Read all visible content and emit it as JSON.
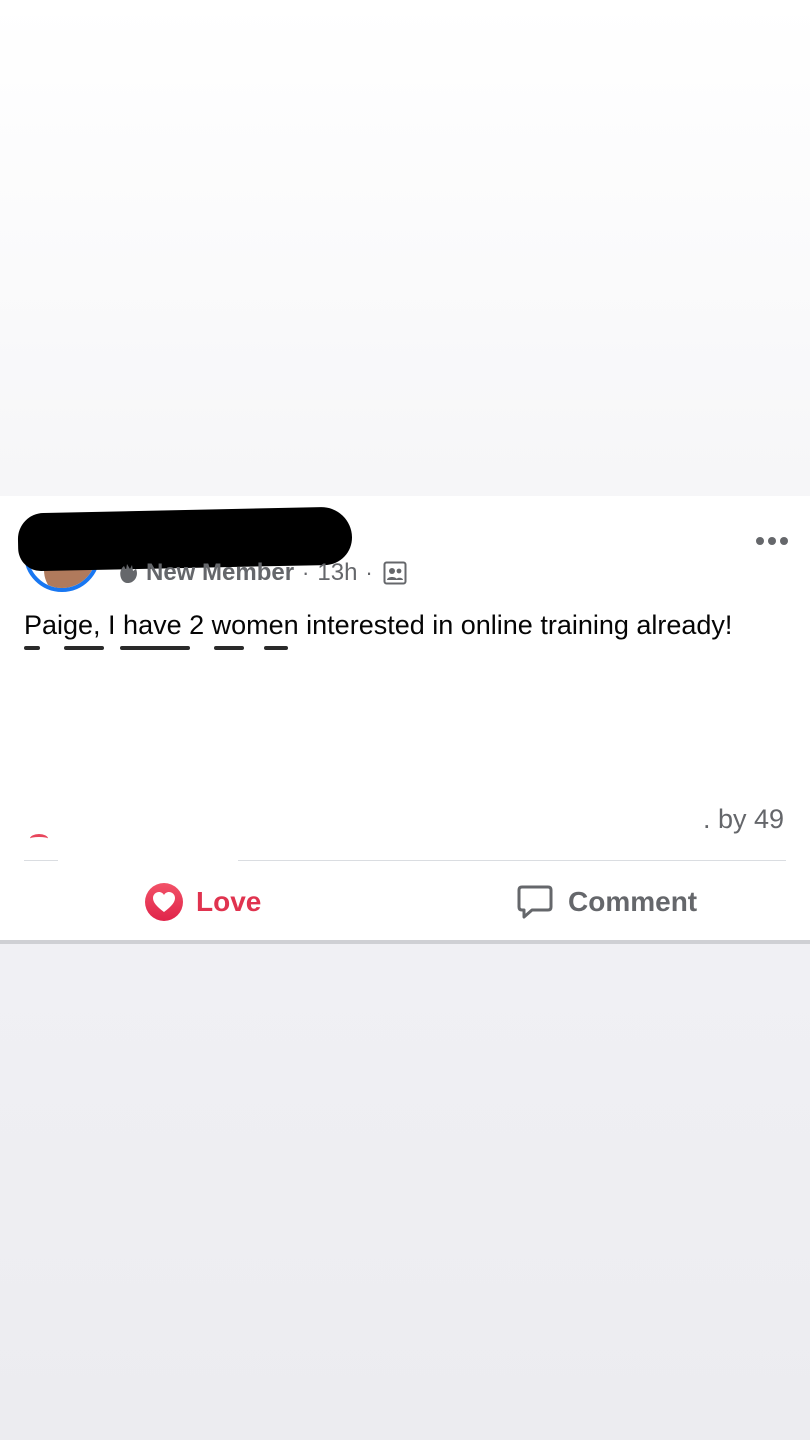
{
  "post": {
    "author_badge_label": "New Member",
    "time": "13h",
    "separator": "·",
    "text": "Paige, I have 2 women interested in online training already!",
    "reactions_count": ". by 49",
    "redacted_name": true
  },
  "actions": {
    "love_label": "Love",
    "comment_label": "Comment"
  },
  "icons": {
    "more": "more-horizontal-icon",
    "badge": "new-member-badge-icon",
    "audience": "group-audience-icon",
    "love": "heart-icon",
    "comment": "comment-bubble-icon"
  },
  "colors": {
    "love": "#e0334f",
    "avatar_ring": "#1877f2",
    "secondary_text": "#65676b"
  }
}
